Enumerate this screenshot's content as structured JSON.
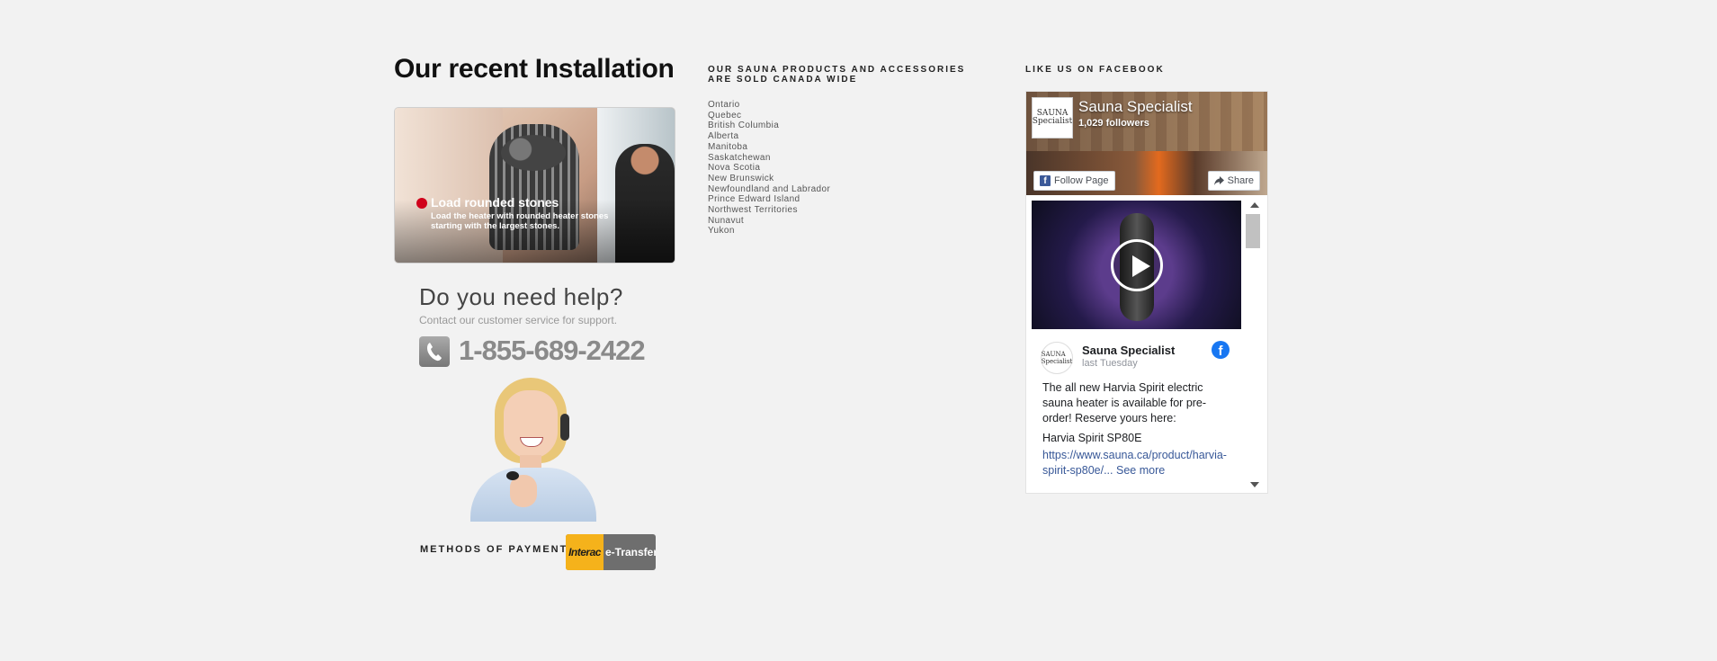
{
  "installation": {
    "heading": "Our recent Installation",
    "image_caption_title": "Load rounded stones",
    "image_caption_sub": "Load the heater with rounded heater stones starting with the largest stones."
  },
  "help": {
    "title": "Do you need help?",
    "subtitle": "Contact our customer service for support.",
    "phone": "1-855-689-2422"
  },
  "payment": {
    "label": "METHODS OF PAYMENT",
    "interac_logo": "Interac",
    "interac_text": "e-Transfer"
  },
  "provinces": {
    "heading": "OUR SAUNA PRODUCTS AND ACCESSORIES ARE SOLD CANADA WIDE",
    "items": [
      "Ontario",
      "Quebec",
      "British Columbia",
      "Alberta",
      "Manitoba",
      "Saskatchewan",
      "Nova Scotia",
      "New Brunswick",
      "Newfoundland and Labrador",
      "Prince Edward Island",
      "Northwest Territories",
      "Nunavut",
      "Yukon"
    ]
  },
  "facebook": {
    "heading": "LIKE US ON FACEBOOK",
    "page_name": "Sauna Specialist",
    "followers": "1,029 followers",
    "follow_label": "Follow Page",
    "share_label": "Share",
    "avatar_text": "SAUNA Specialist",
    "post": {
      "author": "Sauna Specialist",
      "time": "last Tuesday",
      "text": "The all new Harvia Spirit electric sauna heater is available for pre-order! Reserve yours here:",
      "product": "Harvia Spirit SP80E",
      "link": "https://www.sauna.ca/product/harvia-spirit-sp80e/...",
      "see_more": "See more"
    }
  }
}
